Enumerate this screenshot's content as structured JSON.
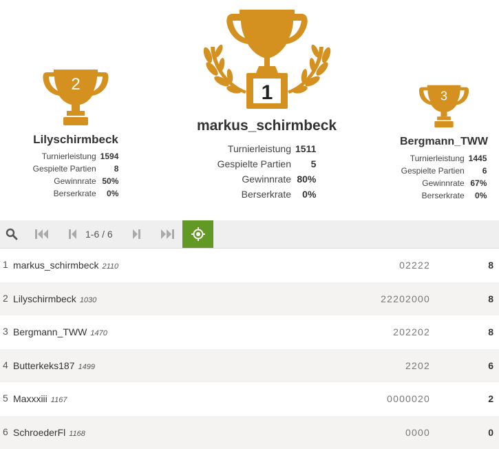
{
  "podium": {
    "first": {
      "rank_label": "1",
      "name": "markus_schirmbeck",
      "stats": [
        {
          "label": "Turnierleistung",
          "value": "1511"
        },
        {
          "label": "Gespielte Partien",
          "value": "5"
        },
        {
          "label": "Gewinnrate",
          "value": "80%"
        },
        {
          "label": "Berserkrate",
          "value": "0%"
        }
      ]
    },
    "second": {
      "rank_label": "2",
      "name": "Lilyschirmbeck",
      "stats": [
        {
          "label": "Turnierleistung",
          "value": "1594"
        },
        {
          "label": "Gespielte Partien",
          "value": "8"
        },
        {
          "label": "Gewinnrate",
          "value": "50%"
        },
        {
          "label": "Berserkrate",
          "value": "0%"
        }
      ]
    },
    "third": {
      "rank_label": "3",
      "name": "Bergmann_TWW",
      "stats": [
        {
          "label": "Turnierleistung",
          "value": "1445"
        },
        {
          "label": "Gespielte Partien",
          "value": "6"
        },
        {
          "label": "Gewinnrate",
          "value": "67%"
        },
        {
          "label": "Berserkrate",
          "value": "0%"
        }
      ]
    },
    "trophy_color": "#d59120"
  },
  "pager": {
    "status": "1-6 / 6",
    "icons": [
      "search-icon",
      "first-page-icon",
      "prev-page-icon",
      "next-page-icon",
      "last-page-icon",
      "target-icon"
    ],
    "active_color": "#629924"
  },
  "standings": [
    {
      "rank": "1",
      "name": "markus_schirmbeck",
      "rating": "2110",
      "sheet": "02222",
      "score": "8"
    },
    {
      "rank": "2",
      "name": "Lilyschirmbeck",
      "rating": "1030",
      "sheet": "22202000",
      "score": "8"
    },
    {
      "rank": "3",
      "name": "Bergmann_TWW",
      "rating": "1470",
      "sheet": "202202",
      "score": "8"
    },
    {
      "rank": "4",
      "name": "Butterkeks187",
      "rating": "1499",
      "sheet": "2202",
      "score": "6"
    },
    {
      "rank": "5",
      "name": "Maxxxiii",
      "rating": "1167",
      "sheet": "0000020",
      "score": "2"
    },
    {
      "rank": "6",
      "name": "SchroederFl",
      "rating": "1168",
      "sheet": "0000",
      "score": "0"
    }
  ]
}
